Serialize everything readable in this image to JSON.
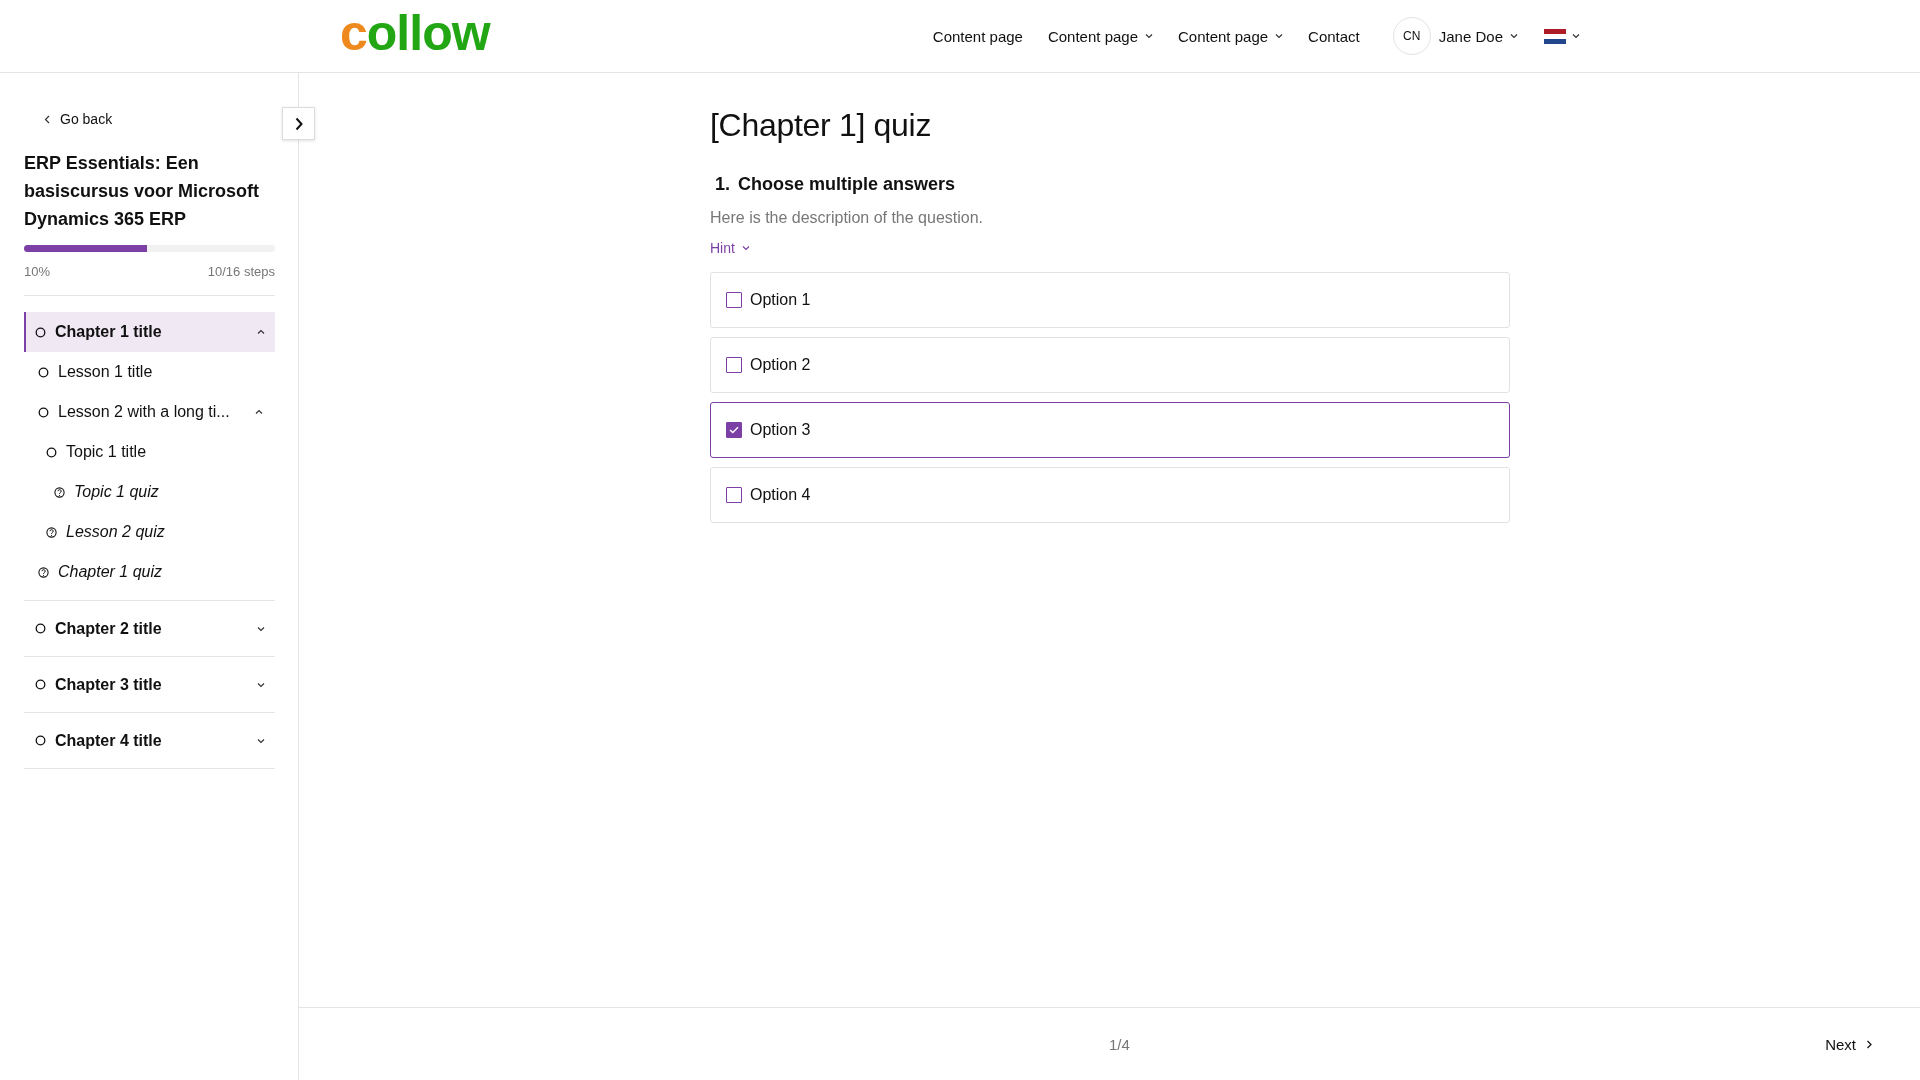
{
  "header": {
    "logo": "collow",
    "nav": [
      {
        "label": "Content page",
        "dropdown": false
      },
      {
        "label": "Content page",
        "dropdown": true
      },
      {
        "label": "Content page",
        "dropdown": true
      },
      {
        "label": "Contact",
        "dropdown": false
      }
    ],
    "user": {
      "initials": "CN",
      "name": "Jane Doe"
    }
  },
  "sidebar": {
    "back": "Go back",
    "course_title": "ERP Essentials: Een basiscursus voor Microsoft Dynamics 365 ERP",
    "progress": {
      "level": 0.49,
      "percent": "10%",
      "steps": "10/16 steps"
    },
    "chapters": [
      {
        "label": "Chapter 1 title",
        "selected": true,
        "expanded": true,
        "children": [
          {
            "kind": "lesson",
            "label": "Lesson 1 title"
          },
          {
            "kind": "lesson",
            "label": "Lesson 2 with a long ti...",
            "expanded": true,
            "children": [
              {
                "kind": "lesson",
                "label": "Topic 1 title",
                "children": [
                  {
                    "kind": "quiz",
                    "label": "Topic 1 quiz"
                  }
                ]
              },
              {
                "kind": "quiz",
                "label": "Lesson 2 quiz"
              }
            ]
          },
          {
            "kind": "quiz",
            "label": "Chapter 1 quiz"
          }
        ]
      },
      {
        "label": "Chapter 2 title",
        "selected": false,
        "expanded": false
      },
      {
        "label": "Chapter 3 title",
        "selected": false,
        "expanded": false
      },
      {
        "label": "Chapter 4 title",
        "selected": false,
        "expanded": false
      }
    ]
  },
  "quiz": {
    "title": "[Chapter 1] quiz",
    "question_number": "1.",
    "question": "Choose multiple answers",
    "description": "Here is the description of the question.",
    "hint": "Hint",
    "options": [
      {
        "label": "Option 1",
        "checked": false
      },
      {
        "label": "Option 2",
        "checked": false
      },
      {
        "label": "Option 3",
        "checked": true
      },
      {
        "label": "Option 4",
        "checked": false
      }
    ]
  },
  "footer": {
    "page": "1/4",
    "next": "Next"
  }
}
